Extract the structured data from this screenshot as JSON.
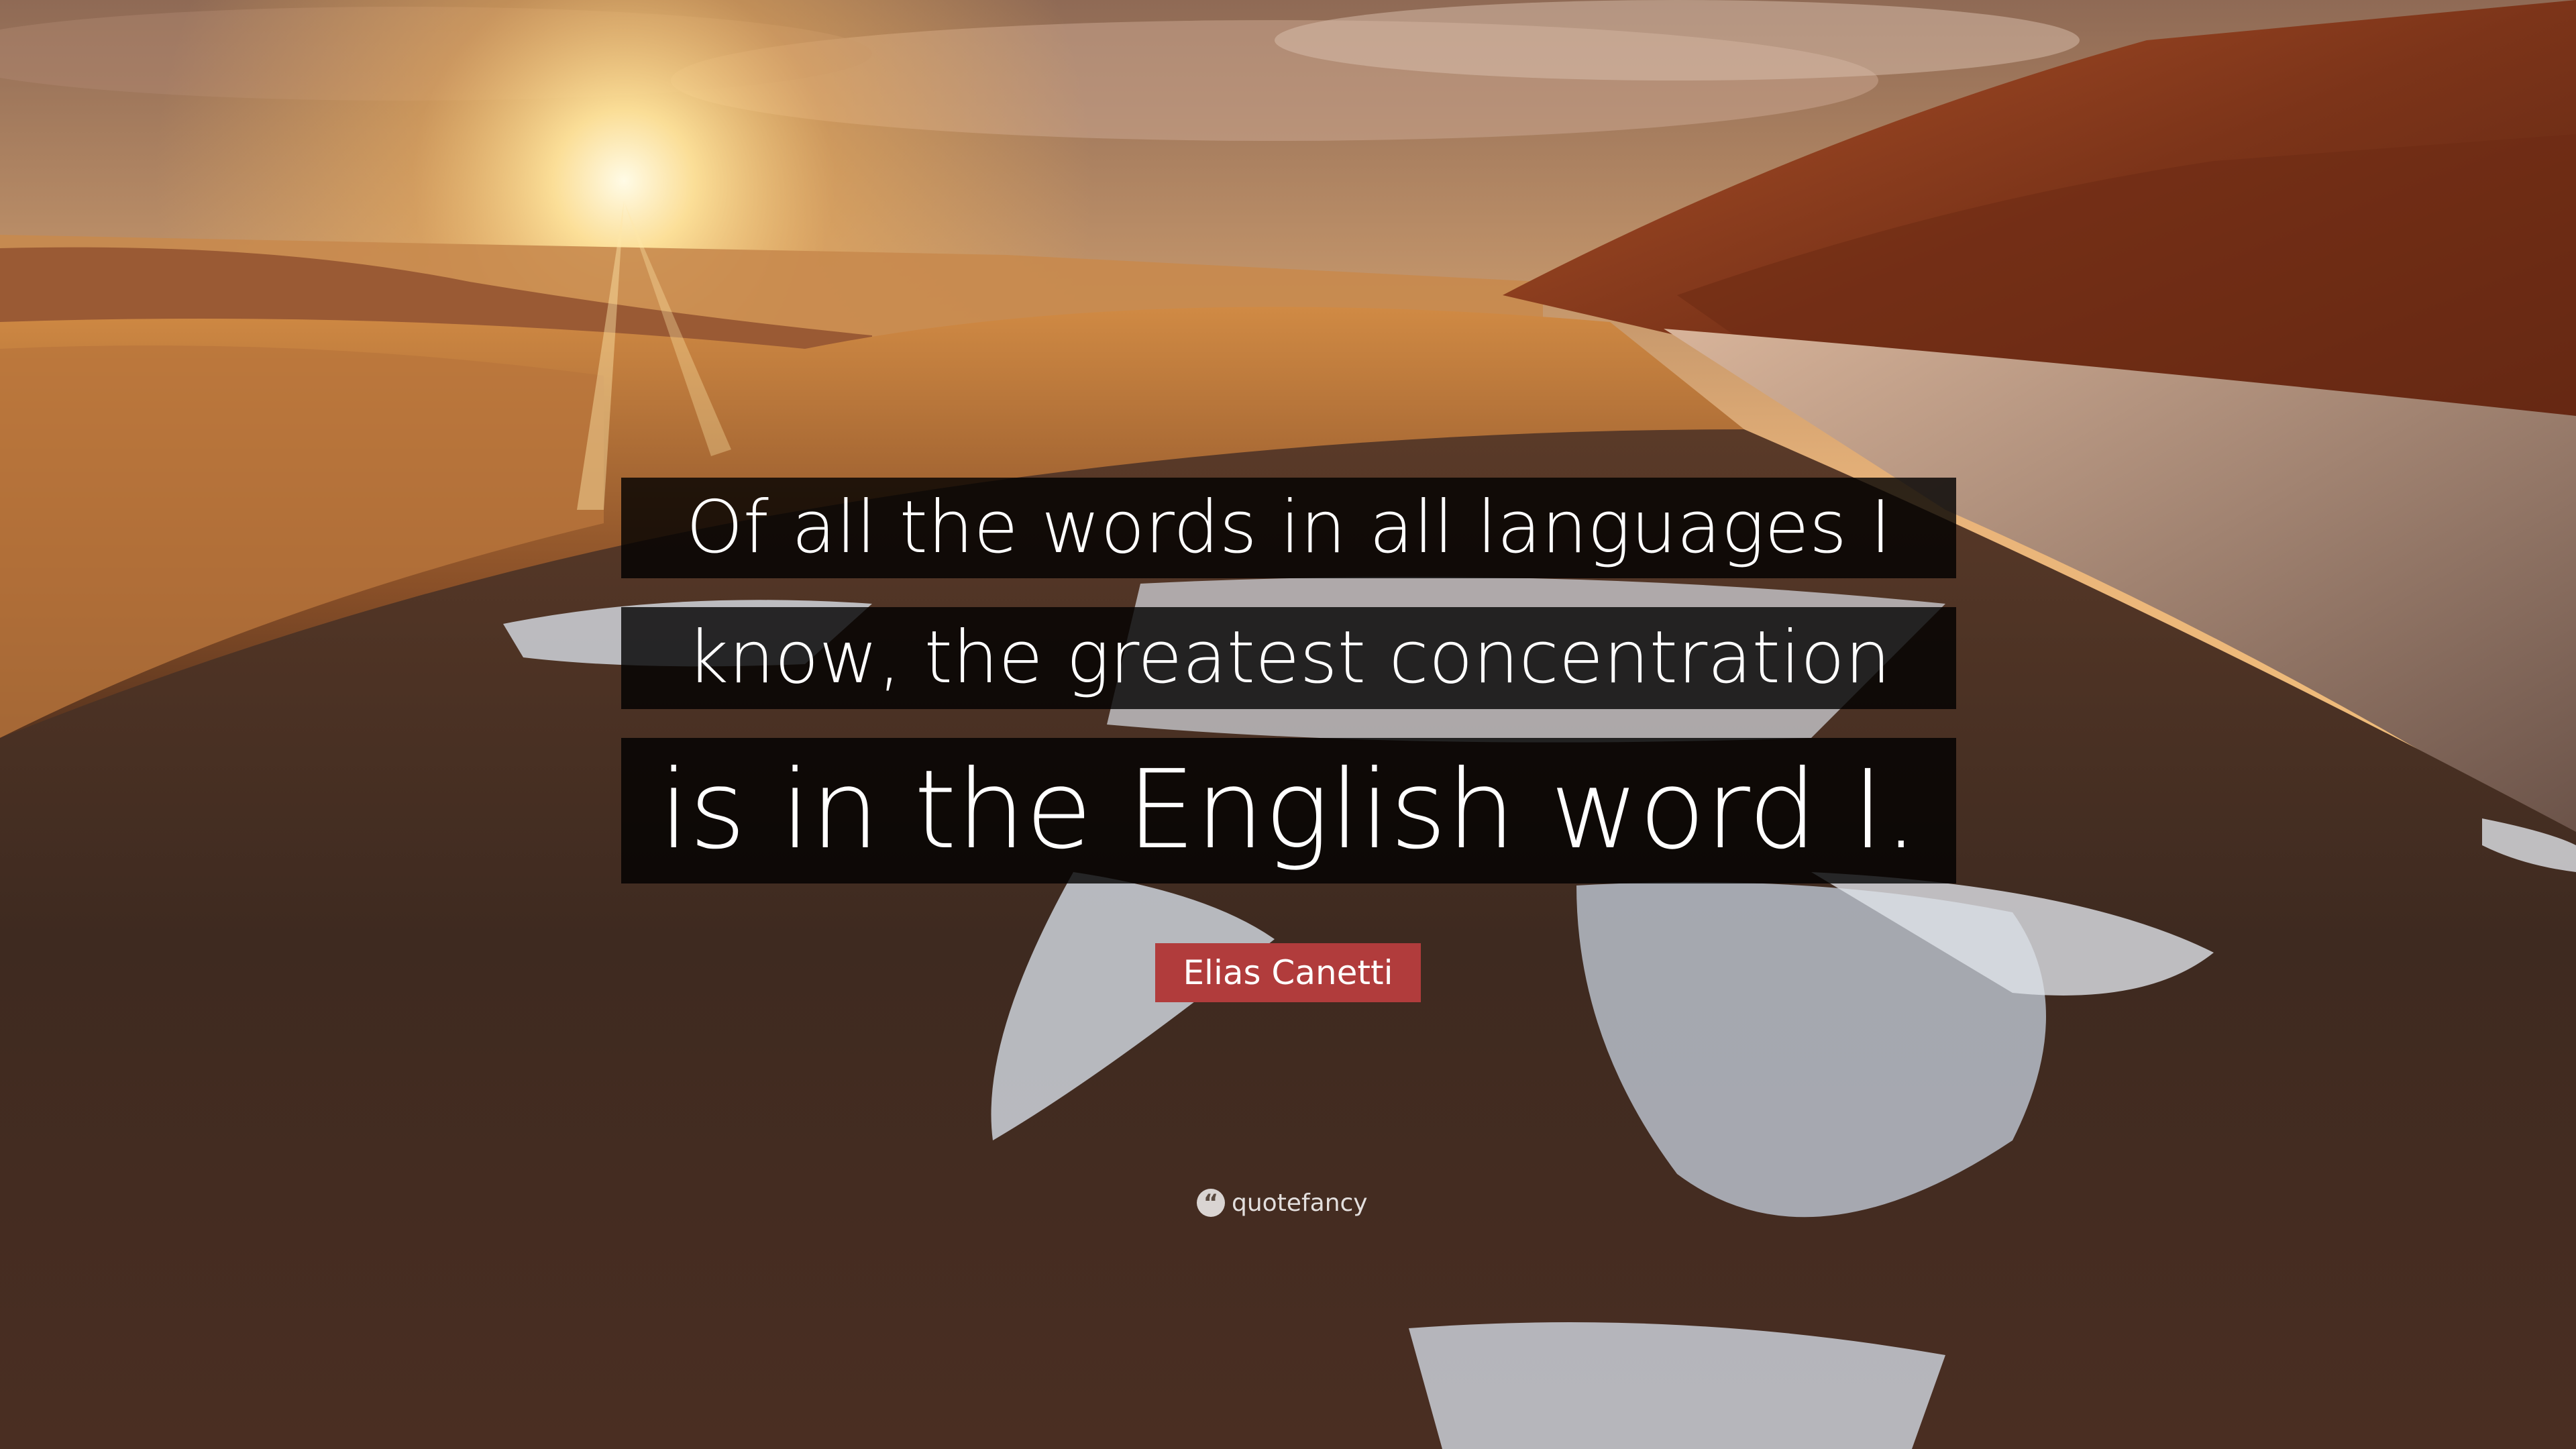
{
  "quote": {
    "lines": [
      "Of all the words in all languages I",
      "know, the greatest concentration",
      "is in the English word I."
    ]
  },
  "author": {
    "name": "Elias Canetti",
    "badge_color": "#b13c3c"
  },
  "watermark": {
    "icon": "quote-icon",
    "logo_text": "quotefancy"
  },
  "background": {
    "description_icon": "landscape-photo"
  }
}
